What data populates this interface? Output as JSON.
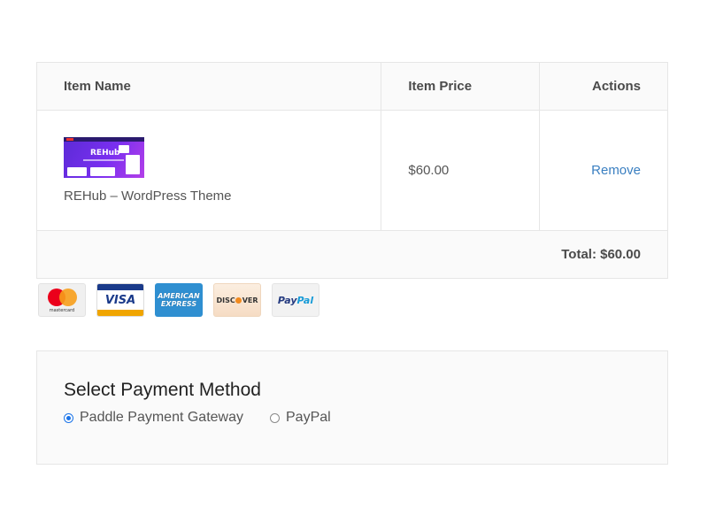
{
  "cart": {
    "headers": {
      "item_name": "Item Name",
      "item_price": "Item Price",
      "actions": "Actions"
    },
    "items": [
      {
        "thumbnail": {
          "logo_text": "REHub",
          "colors": {
            "primary": "#6a2de6",
            "accent": "#b33fe8"
          }
        },
        "name": "REHub – WordPress Theme",
        "price": "$60.00",
        "action_label": "Remove"
      }
    ],
    "total_label": "Total: $60.00"
  },
  "payment_cards": [
    {
      "name": "mastercard",
      "label": "mastercard"
    },
    {
      "name": "visa",
      "label": "VISA"
    },
    {
      "name": "amex",
      "label_line1": "AMERICAN",
      "label_line2": "EXPRESS"
    },
    {
      "name": "discover",
      "label_before": "DISC",
      "label_after": "VER"
    },
    {
      "name": "paypal",
      "label_part1": "Pay",
      "label_part2": "Pal"
    }
  ],
  "payment_method": {
    "title": "Select Payment Method",
    "options": [
      {
        "label": "Paddle Payment Gateway",
        "selected": true
      },
      {
        "label": "PayPal",
        "selected": false
      }
    ]
  },
  "colors": {
    "link": "#3a7fc1",
    "radio_selected": "#1a73e8",
    "table_border": "#e6e6e6",
    "header_bg": "#fafafa"
  }
}
